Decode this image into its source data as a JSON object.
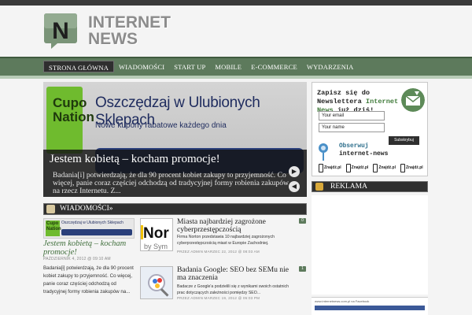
{
  "brand": {
    "logo_letters": "N",
    "name_line1": "INTERNET",
    "name_line2": "NEWS"
  },
  "nav": [
    {
      "label": "STRONA GŁÓWNA",
      "active": true
    },
    {
      "label": "WIADOMOŚCI",
      "active": false
    },
    {
      "label": "START UP",
      "active": false
    },
    {
      "label": "MOBILE",
      "active": false
    },
    {
      "label": "E-COMMERCE",
      "active": false
    },
    {
      "label": "WYDARZENIA",
      "active": false
    }
  ],
  "slider": {
    "image_brand": "Cupo Nation",
    "image_headline": "Oszczędzaj w Ulubionych Sklepach",
    "image_subline": "Nowe kupony rabatowe każdego dnia",
    "title": "Jestem kobietą – kocham promocje!",
    "excerpt": "Badania[i] potwierdzają, że dla 90 procent kobiet zakupy to przyjemność. Co więcej, panie coraz częściej odchodzą od tradycyjnej formy robienia zakupów na rzecz Internetu.   Z...",
    "next_icon": "chevron-right-icon",
    "prev_icon": "chevron-left-icon"
  },
  "section": {
    "title": "WIADOMOŚCI»"
  },
  "featured": {
    "thumb_brand": "Cupo Nation",
    "thumb_headline": "Oszczędzaj w Ulubionych Sklepach",
    "title": "Jestem kobietą – kocham promocje!",
    "meta": "PAŹDZIERNIK 4, 2012 @ 09:10 AM",
    "excerpt": "Badania[i] potwierdzają, że dla 90 procent kobiet zakupy to przyjemność. Co więcej, panie coraz częściej odchodzą od tradycyjnej formy robienia zakupów na..."
  },
  "posts": [
    {
      "thumb": "Norton by Symantec",
      "title": "Miasta najbardziej zagrożone cyberprzestępczością",
      "excerpt": "Firma Norton przedstawia 10 najbardziej zagrożonych cyberprzestępczością miast w Europie Zachodniej.",
      "meta": "PRZEZ ADMIN MARZEC 22, 2012 @ 08:03 AM",
      "comments": "0"
    },
    {
      "thumb": "Google",
      "title": "Badania Google: SEO bez SEMu nie ma znaczenia",
      "excerpt": "Badacze z Google'a podzielili się z wynikami swoich ostatnich prac dotyczących zależności pomiędzy SEO...",
      "meta": "PRZEZ ADMIN MARZEC 19, 2012 @ 05:03 PM",
      "comments": "1"
    }
  ],
  "newsletter": {
    "title_part1": "Zapisz się do Newslettera",
    "title_green": "Internet News",
    "title_part2": "już dziś!",
    "email_value": "Your email",
    "name_value": "Your name",
    "button": "Subskrybuj",
    "follow_label": "Obserwuj",
    "follow_name": "internet-news",
    "phones": [
      "Znajdź.pl",
      "Znajdź.pl",
      "Znajdź.pl",
      "Znajdź.pl"
    ]
  },
  "reklama": {
    "title": "REKLAMA",
    "ad_caption": "www.internetnews.com.pl na Facebook"
  },
  "colors": {
    "nav_green": "#5d7a5c",
    "dark": "#2f2f2f",
    "accent_green": "#3f6e3b"
  }
}
